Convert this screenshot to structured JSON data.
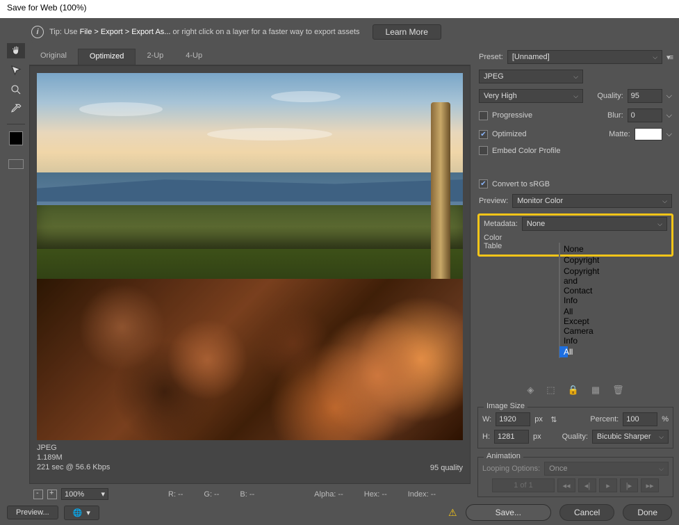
{
  "window": {
    "title": "Save for Web (100%)"
  },
  "tip": {
    "prefix": "Tip: Use ",
    "path": "File > Export > Export As...",
    "suffix": "  or right click on a layer for a faster way to export assets",
    "learn_more": "Learn More"
  },
  "tabs": {
    "original": "Original",
    "optimized": "Optimized",
    "two_up": "2-Up",
    "four_up": "4-Up"
  },
  "preview_info": {
    "format": "JPEG",
    "size": "1.189M",
    "time": "221 sec @ 56.6 Kbps",
    "quality": "95 quality"
  },
  "readouts": {
    "r": "R: --",
    "g": "G: --",
    "b": "B: --",
    "alpha": "Alpha: --",
    "hex": "Hex: --",
    "index": "Index: --"
  },
  "zoom": "100%",
  "preset": {
    "label": "Preset:",
    "value": "[Unnamed]"
  },
  "format": {
    "value": "JPEG"
  },
  "compression": {
    "value": "Very High"
  },
  "quality": {
    "label": "Quality:",
    "value": "95"
  },
  "progressive": {
    "label": "Progressive"
  },
  "blur": {
    "label": "Blur:",
    "value": "0"
  },
  "optimized": {
    "label": "Optimized"
  },
  "matte": {
    "label": "Matte:"
  },
  "embed": {
    "label": "Embed Color Profile"
  },
  "convert_srgb": {
    "label": "Convert to sRGB"
  },
  "preview_sel": {
    "label": "Preview:",
    "value": "Monitor Color"
  },
  "metadata": {
    "label": "Metadata:",
    "value": "None",
    "options": [
      "None",
      "Copyright",
      "Copyright and Contact Info",
      "All Except Camera Info",
      "All"
    ],
    "selected": "All"
  },
  "color_table": {
    "label": "Color Table"
  },
  "image_size": {
    "title": "Image Size",
    "w_label": "W:",
    "w": "1920",
    "px1": "px",
    "h_label": "H:",
    "h": "1281",
    "px2": "px",
    "percent_label": "Percent:",
    "percent": "100",
    "pct_suffix": "%",
    "quality_label": "Quality:",
    "quality": "Bicubic Sharper"
  },
  "animation": {
    "title": "Animation",
    "loop_label": "Looping Options:",
    "loop_value": "Once",
    "pager": "1 of 1"
  },
  "buttons": {
    "preview": "Preview...",
    "save": "Save...",
    "cancel": "Cancel",
    "done": "Done"
  }
}
